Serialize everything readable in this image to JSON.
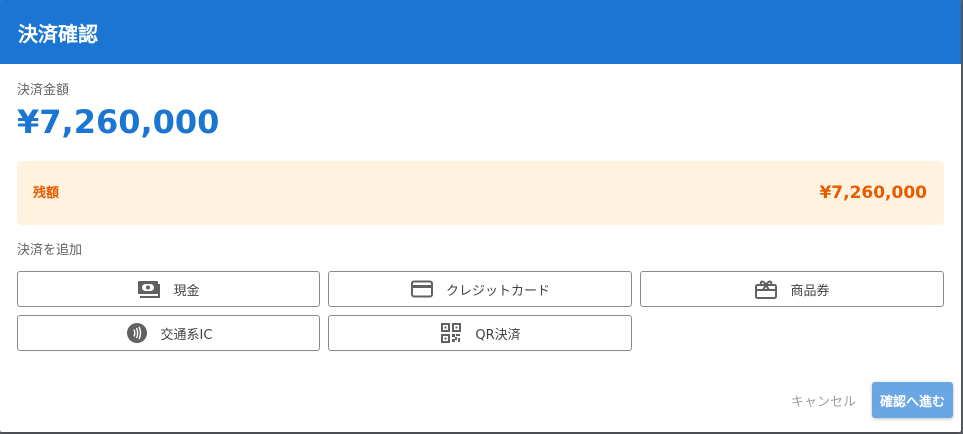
{
  "dialog": {
    "title": "決済確認"
  },
  "amount": {
    "label": "決済金額",
    "value": "¥7,260,000"
  },
  "remaining": {
    "label": "残額",
    "value": "¥7,260,000"
  },
  "add_payment": {
    "label": "決済を追加",
    "methods": [
      {
        "label": "現金",
        "icon": "cash-icon"
      },
      {
        "label": "クレジットカード",
        "icon": "credit-card-icon"
      },
      {
        "label": "商品券",
        "icon": "gift-card-icon"
      },
      {
        "label": "交通系IC",
        "icon": "contactless-icon"
      },
      {
        "label": "QR決済",
        "icon": "qr-code-icon"
      }
    ]
  },
  "footer": {
    "cancel_label": "キャンセル",
    "confirm_label": "確認へ進む"
  },
  "colors": {
    "primary": "#1a76d2",
    "remaining_bg": "#fff3e0",
    "remaining_text": "#e65c00"
  }
}
